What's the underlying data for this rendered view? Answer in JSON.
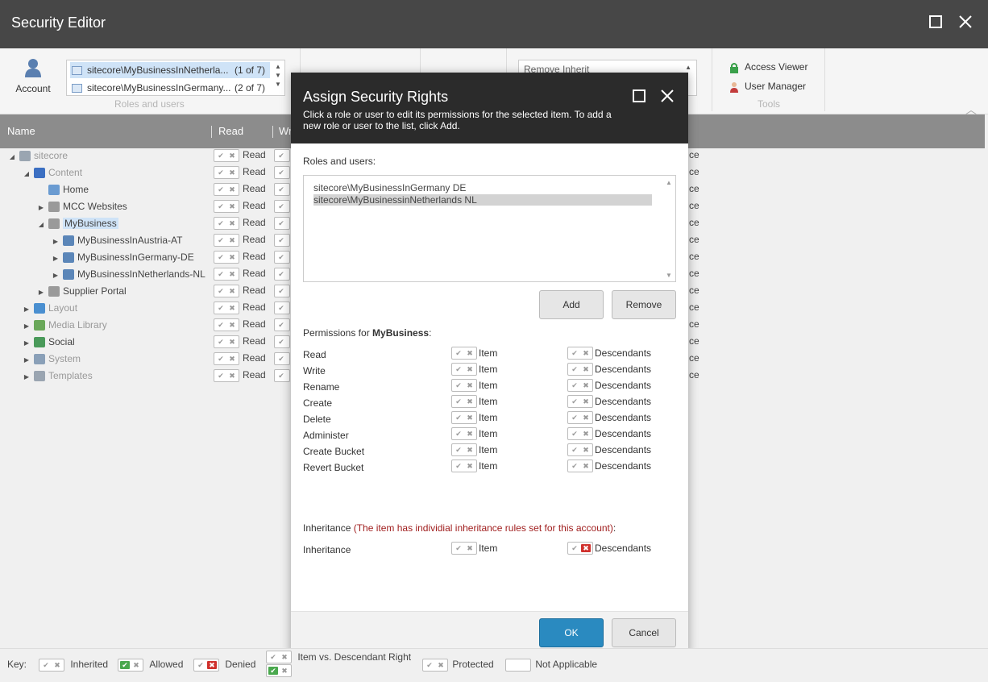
{
  "window": {
    "title": "Security Editor",
    "maximize_icon": "square-icon",
    "close_icon": "close-icon"
  },
  "ribbon": {
    "account_label": "Account",
    "roles": [
      {
        "name": "sitecore\\MyBusinessInNetherla...",
        "count": "(1 of 7)"
      },
      {
        "name": "sitecore\\MyBusinessInGermany...",
        "count": "(2 of 7)"
      }
    ],
    "roles_group_label": "Roles and users",
    "inherit_value": "Remove Inherit",
    "tools": {
      "access_viewer": "Access Viewer",
      "user_manager": "User Manager",
      "group_label": "Tools"
    }
  },
  "grid": {
    "headers": {
      "name": "Name",
      "read": "Read",
      "write_partial": "Wr"
    },
    "perm_label": "Read",
    "right_partial": "ce",
    "nodes": [
      {
        "label": "sitecore",
        "level": 0,
        "toggle": "open",
        "dim": true,
        "icon": "page-icon",
        "color": "#9aa5b1"
      },
      {
        "label": "Content",
        "level": 1,
        "toggle": "open",
        "dim": true,
        "icon": "content-icon",
        "color": "#3b6fc2"
      },
      {
        "label": "Home",
        "level": 2,
        "toggle": "",
        "dim": false,
        "icon": "home-icon",
        "color": "#6a9bd1"
      },
      {
        "label": "MCC Websites",
        "level": 2,
        "toggle": "closed",
        "dim": false,
        "icon": "building-icon",
        "color": "#9a9a9a"
      },
      {
        "label": "MyBusiness",
        "level": 2,
        "toggle": "open",
        "dim": false,
        "sel": true,
        "icon": "building-icon",
        "color": "#9a9a9a"
      },
      {
        "label": "MyBusinessInAustria-AT",
        "level": 3,
        "toggle": "closed",
        "dim": false,
        "icon": "globe-icon",
        "color": "#5b86b8"
      },
      {
        "label": "MyBusinessInGermany-DE",
        "level": 3,
        "toggle": "closed",
        "dim": false,
        "icon": "globe-icon",
        "color": "#5b86b8"
      },
      {
        "label": "MyBusinessInNetherlands-NL",
        "level": 3,
        "toggle": "closed",
        "dim": false,
        "icon": "globe-icon",
        "color": "#5b86b8"
      },
      {
        "label": "Supplier Portal",
        "level": 2,
        "toggle": "closed",
        "dim": false,
        "icon": "building-icon",
        "color": "#9a9a9a"
      },
      {
        "label": "Layout",
        "level": 1,
        "toggle": "closed",
        "dim": true,
        "icon": "layout-icon",
        "color": "#4a8fd0"
      },
      {
        "label": "Media Library",
        "level": 1,
        "toggle": "closed",
        "dim": true,
        "icon": "image-icon",
        "color": "#6aa85a"
      },
      {
        "label": "Social",
        "level": 1,
        "toggle": "closed",
        "dim": false,
        "icon": "social-icon",
        "color": "#4a9a5a"
      },
      {
        "label": "System",
        "level": 1,
        "toggle": "closed",
        "dim": true,
        "icon": "system-icon",
        "color": "#8aa0b8"
      },
      {
        "label": "Templates",
        "level": 1,
        "toggle": "closed",
        "dim": true,
        "icon": "template-icon",
        "color": "#9aa5b1"
      }
    ]
  },
  "dialog": {
    "title": "Assign Security Rights",
    "subtitle": "Click a role or user to edit its permissions for the selected item. To add a new role or user to the list, click Add.",
    "roles_label": "Roles and users:",
    "roles": [
      "sitecore\\MyBusinessInGermany DE",
      "sitecore\\MyBusinessinNetherlands NL"
    ],
    "add": "Add",
    "remove": "Remove",
    "permissions_prefix": "Permissions for ",
    "permissions_item": "MyBusiness",
    "permissions_suffix": ":",
    "item_label": "Item",
    "desc_label": "Descendants",
    "permissions": [
      "Read",
      "Write",
      "Rename",
      "Create",
      "Delete",
      "Administer",
      "Create Bucket",
      "Revert Bucket"
    ],
    "inheritance_prefix": "Inheritance ",
    "inheritance_note": "(The item has individial inheritance rules set for this account)",
    "inheritance_suffix": ":",
    "inheritance_row": "Inheritance",
    "ok": "OK",
    "cancel": "Cancel"
  },
  "key": {
    "label": "Key:",
    "inherited": "Inherited",
    "allowed": "Allowed",
    "denied": "Denied",
    "item_vs_desc": "Item vs. Descendant Right",
    "protected": "Protected",
    "not_applicable": "Not Applicable"
  }
}
